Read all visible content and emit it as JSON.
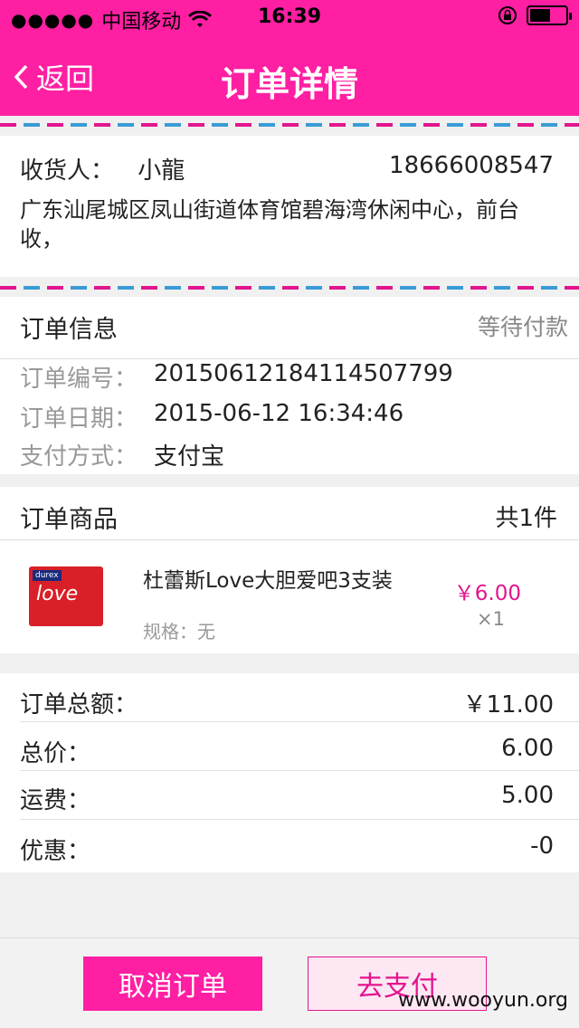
{
  "status_bar": {
    "signal": "●●●●●",
    "carrier": "中国移动",
    "time": "16:39"
  },
  "nav": {
    "back_label": "返回",
    "title": "订单详情"
  },
  "address": {
    "recipient_label": "收货人：",
    "recipient_name": "小龍",
    "phone": "18666008547",
    "address_text": "广东汕尾城区凤山街道体育馆碧海湾休闲中心，前台收，"
  },
  "order_info": {
    "header": "订单信息",
    "status": "等待付款",
    "number_label": "订单编号：",
    "number_value": "20150612184114507799",
    "date_label": "订单日期：",
    "date_value": "2015-06-12 16:34:46",
    "pay_label": "支付方式：",
    "pay_value": "支付宝"
  },
  "goods": {
    "header": "订单商品",
    "count": "共1件",
    "item": {
      "name": "杜蕾斯Love大胆爱吧3支装",
      "spec": "规格：无",
      "price": "￥6.00",
      "qty": "×1",
      "thumb_brand": "durex",
      "thumb_text": "love"
    }
  },
  "summary": {
    "total_label": "订单总额：",
    "total_value": "￥11.00",
    "price_label": "总价：",
    "price_value": "6.00",
    "shipping_label": "运费：",
    "shipping_value": "5.00",
    "discount_label": "优惠：",
    "discount_value": "-0"
  },
  "actions": {
    "cancel_label": "取消订单",
    "pay_label": "去支付"
  },
  "watermark": "www.wooyun.org",
  "colors": {
    "brand": "#ff1fa3",
    "accent": "#e2158f",
    "dash_blue": "#3a9bd6"
  }
}
